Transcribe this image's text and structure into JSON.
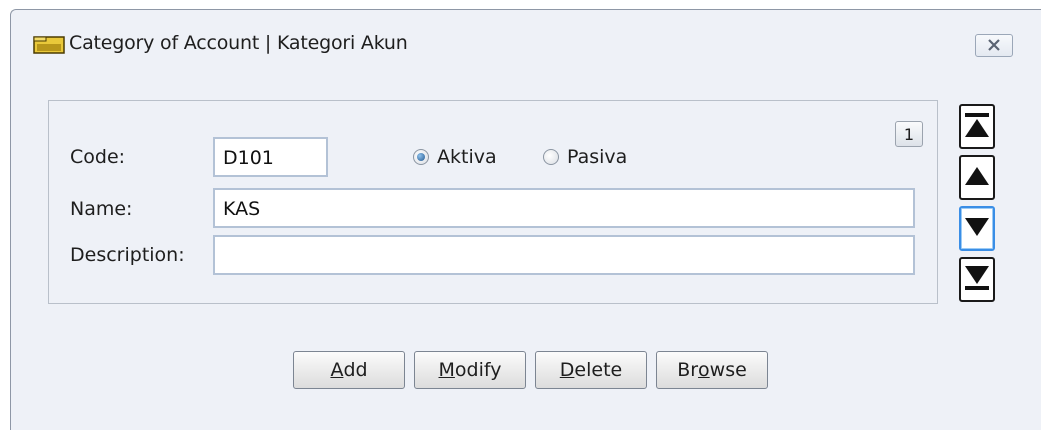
{
  "window": {
    "title": "Category of Account | Kategori Akun",
    "icon": "folder-icon",
    "close_icon": "close-icon"
  },
  "form": {
    "record_number": "1",
    "code": {
      "label": "Code:",
      "value": "D101"
    },
    "type": {
      "options": [
        {
          "label": "Aktiva",
          "selected": true
        },
        {
          "label": "Pasiva",
          "selected": false
        }
      ]
    },
    "name": {
      "label": "Name:",
      "value": "KAS"
    },
    "description": {
      "label": "Description:",
      "value": ""
    }
  },
  "navigation": {
    "first_icon": "first-record-icon",
    "previous_icon": "previous-record-icon",
    "next_icon": "next-record-icon",
    "last_icon": "last-record-icon"
  },
  "buttons": {
    "add": {
      "accel": "A",
      "rest": "dd"
    },
    "modify": {
      "accel": "M",
      "rest": "odify"
    },
    "delete": {
      "accel": "D",
      "rest": "elete"
    },
    "browse": {
      "pre": "Br",
      "accel": "o",
      "rest": "wse"
    }
  },
  "colors": {
    "accent": "#3a8ee6",
    "window_bg": "#eef1f7",
    "field_border": "#b3c2d6"
  }
}
